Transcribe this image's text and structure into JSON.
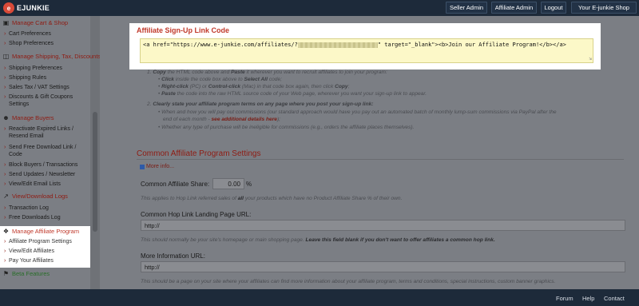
{
  "brand": {
    "name": "EJUNKIE",
    "mark": "e",
    "accent": "#d94a38"
  },
  "top_nav": {
    "seller_admin": "Seller Admin",
    "affiliate_admin": "Affiliate Admin",
    "logout": "Logout",
    "your_shop": "Your E-junkie Shop"
  },
  "sidebar": {
    "cart": {
      "title": "Manage Cart & Shop",
      "items": [
        "Cart Preferences",
        "Shop Preferences"
      ]
    },
    "shipping": {
      "title": "Manage Shipping, Tax, Discounts",
      "items": [
        "Shipping Preferences",
        "Shipping Rules",
        "Sales Tax / VAT Settings",
        "Discounts & Gift Coupons Settings"
      ]
    },
    "buyers": {
      "title": "Manage Buyers",
      "items": [
        "Reactivate Expired Links / Resend Email",
        "Send Free Download Link / Code",
        "Block Buyers / Transactions",
        "Send Updates / Newsletter",
        "View/Edit Email Lists"
      ]
    },
    "logs": {
      "title": "View/Download Logs",
      "items": [
        "Transaction Log",
        "Free Downloads Log"
      ]
    },
    "affiliate": {
      "title": "Manage Affiliate Program",
      "items": [
        "Affiliate Program Settings",
        "View/Edit Affiliates",
        "Pay Your Affiliates"
      ]
    },
    "beta": {
      "title": "Beta Features"
    }
  },
  "signup": {
    "title": "Affiliate Sign-Up Link Code",
    "code_before": "<a href=\"https://www.e-junkie.com/affiliates/?",
    "code_after": "\" target=\"_blank\"><b>Join our Affiliate Program!</b></a>"
  },
  "instructions": {
    "step1_a": "Copy",
    "step1_b": " the HTML code above and ",
    "step1_c": "Paste",
    "step1_d": " it wherever you want to recruit affiliates to join your program:",
    "bullet1_a": "Click",
    "bullet1_b": " inside the code box above to ",
    "bullet1_c": "Select All",
    "bullet1_d": " code;",
    "bullet2_a": "Right-click",
    "bullet2_b": " (PC) or ",
    "bullet2_c": "Control-click",
    "bullet2_d": " (Mac) in that code box again, then click ",
    "bullet2_e": "Copy",
    "bullet2_f": ";",
    "bullet3_a": "Paste",
    "bullet3_b": " the code into the raw HTML source code of your Web page, wherever you want your sign-up link to appear.",
    "step2": "Clearly state your affiliate program terms on any page where you post your sign-up link:",
    "bullet4_a": "When and how you will pay out commissions (our standard approach would have you pay out an automated batch of monthly lump-sum commissions via PayPal after the",
    "bullet4_b": "end of each month - ",
    "bullet4_link": "see additional details here",
    "bullet4_c": ");",
    "bullet5": "Whether any type of purchase will be ineligible for commissions (e.g., orders the affiliate places themselves)."
  },
  "settings": {
    "title": "Common Affiliate Program Settings",
    "more_info": "More info...",
    "share_label": "Common Affiliate Share:",
    "share_value": "0.00",
    "share_unit": "%",
    "share_hint_a": "This applies to Hop Link referred sales of ",
    "share_hint_b": "all",
    "share_hint_c": " your products which have no Product Affiliate Share % of their own.",
    "hop_label": "Common Hop Link Landing Page URL:",
    "hop_value": "http://",
    "hop_hint_a": "This should normally be your site's homepage or main shopping page. ",
    "hop_hint_b": "Leave this field blank if you don't want to offer affiliates a common hop link.",
    "info_label": "More Information URL:",
    "info_value": "http://",
    "info_hint": "This should be a page on your site where your affiliates can find more information about your affiliate program, terms and conditions, special instructions, custom banner graphics."
  },
  "footer": {
    "forum": "Forum",
    "help": "Help",
    "contact": "Contact"
  }
}
